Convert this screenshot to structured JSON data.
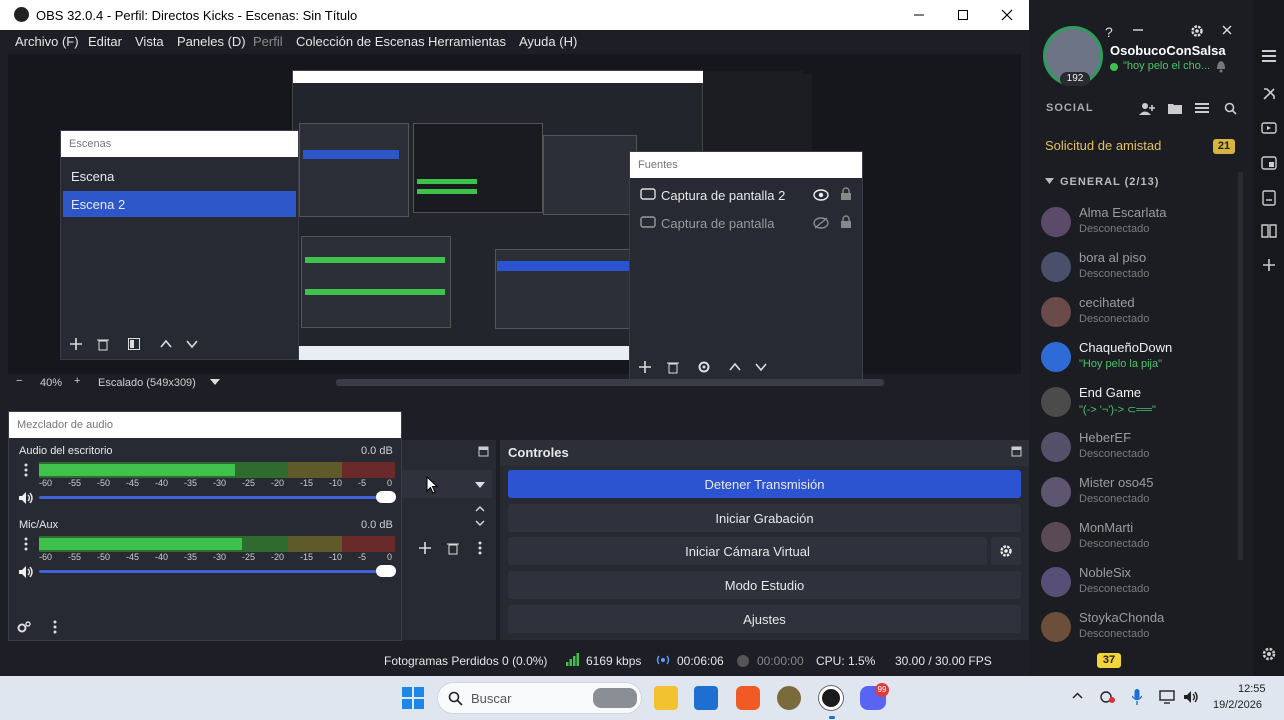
{
  "window": {
    "title": "OBS 32.0.4 - Perfil: Directos Kicks - Escenas: Sin Título"
  },
  "menu": [
    "Archivo (F)",
    "Editar",
    "Vista",
    "Paneles (D)",
    "Perfil",
    "Colección de Escenas",
    "Herramientas",
    "Ayuda (H)"
  ],
  "scenes": {
    "title": "Escenas",
    "items": [
      "Escena",
      "Escena 2"
    ],
    "selected": 1
  },
  "sources": {
    "title": "Fuentes",
    "items": [
      {
        "label": "Captura de pantalla 2",
        "visible": true
      },
      {
        "label": "Captura de pantalla",
        "visible": false
      }
    ]
  },
  "preview_bar": {
    "zoom": "40%",
    "scale": "Escalado (549x309)"
  },
  "mixer": {
    "title": "Mezclador de audio",
    "channels": [
      {
        "name": "Audio del escritorio",
        "db": "0.0 dB",
        "level": 0.55
      },
      {
        "name": "Mic/Aux",
        "db": "0.0 dB",
        "level": 0.57
      }
    ],
    "ticks": [
      "-60",
      "-55",
      "-50",
      "-45",
      "-40",
      "-35",
      "-30",
      "-25",
      "-20",
      "-15",
      "-10",
      "-5",
      "0"
    ]
  },
  "controls": {
    "title": "Controles",
    "buttons": [
      "Detener Transmisión",
      "Iniciar Grabación",
      "Iniciar Cámara Virtual",
      "Modo Estudio",
      "Ajustes"
    ]
  },
  "status": {
    "dropped": "Fotogramas Perdidos 0 (0.0%)",
    "bitrate": "6169 kbps",
    "stream_time": "00:06:06",
    "rec_time": "00:00:00",
    "cpu": "CPU: 1.5%",
    "fps": "30.00 / 30.00 FPS"
  },
  "discord": {
    "username": "OsobucoConSalsa",
    "status": "\"hoy pelo el cho...",
    "level": "192",
    "social_label": "SOCIAL",
    "friend_request": "Solicitud de amistad",
    "friend_request_count": "21",
    "group": "GENERAL (2/13)",
    "friends": [
      {
        "name": "Alma Escarlata",
        "status": "Desconectado",
        "online": false
      },
      {
        "name": "bora al piso",
        "status": "Desconectado",
        "online": false
      },
      {
        "name": "cecihated",
        "status": "Desconectado",
        "online": false
      },
      {
        "name": "ChaqueñoDown",
        "status": "\"Hoy pelo la pija\"",
        "online": true
      },
      {
        "name": "End Game",
        "status": "\"(-> '¬')-> ⊂══\"",
        "online": true
      },
      {
        "name": "HeberEF",
        "status": "Desconectado",
        "online": false
      },
      {
        "name": "Mister oso45",
        "status": "Desconectado",
        "online": false
      },
      {
        "name": "MonMarti",
        "status": "Desconectado",
        "online": false
      },
      {
        "name": "NobleSix",
        "status": "Desconectado",
        "online": false
      },
      {
        "name": "StoykaChonda",
        "status": "Desconectado",
        "online": false
      }
    ],
    "badge": "37"
  },
  "taskbar": {
    "search_placeholder": "Buscar",
    "time": "12:55",
    "date": "19/2/2026",
    "discord_badge": "99"
  }
}
